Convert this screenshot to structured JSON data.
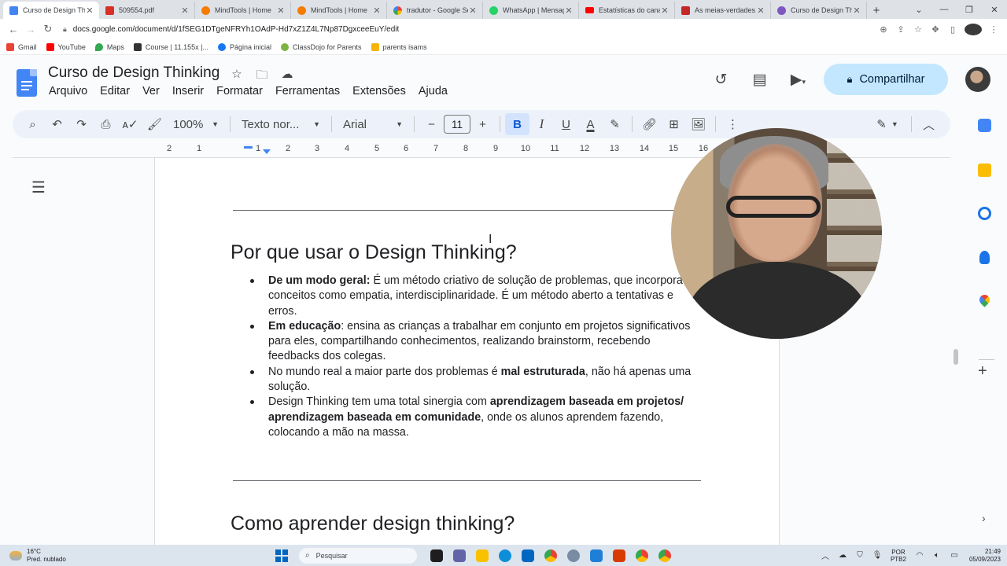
{
  "browser": {
    "tabs": [
      {
        "label": "Curso de Design Thinking",
        "color": "#4285f4",
        "active": true
      },
      {
        "label": "509554.pdf",
        "color": "#d93025"
      },
      {
        "label": "MindTools | Home",
        "color": "#f57c00"
      },
      {
        "label": "MindTools | Home",
        "color": "#f57c00"
      },
      {
        "label": "tradutor - Google Search",
        "color": "#4285f4"
      },
      {
        "label": "WhatsApp | Mensagens",
        "color": "#25d366"
      },
      {
        "label": "Estatísticas do canal",
        "color": "#ff0000"
      },
      {
        "label": "As meias-verdades, p",
        "color": "#c62828"
      },
      {
        "label": "Curso de Design Thinking",
        "color": "#7e57c2"
      }
    ],
    "new_tab": "+",
    "url": "docs.google.com/document/d/1fSEG1DTgeNFRYh1OAdP-Hd7xZ1Z4L7Np87DgxceeEuY/edit",
    "bookmarks": [
      {
        "label": "Gmail",
        "color": "#ea4335"
      },
      {
        "label": "YouTube",
        "color": "#ff0000"
      },
      {
        "label": "Maps",
        "color": "#34a853"
      },
      {
        "label": "Course | 11.155x |...",
        "color": "#333333"
      },
      {
        "label": "Página inicial",
        "color": "#1877f2"
      },
      {
        "label": "ClassDojo for Parents",
        "color": "#7cb342"
      },
      {
        "label": "parents isams",
        "color": "#f6b400"
      }
    ]
  },
  "docs": {
    "title": "Curso de Design Thinking",
    "menu": [
      "Arquivo",
      "Editar",
      "Ver",
      "Inserir",
      "Formatar",
      "Ferramentas",
      "Extensões",
      "Ajuda"
    ],
    "share_label": "Compartilhar",
    "toolbar": {
      "zoom": "100%",
      "style": "Texto nor...",
      "font": "Arial",
      "font_size": "11",
      "bold": "B",
      "italic": "I",
      "underline": "U",
      "text_color": "A"
    },
    "ruler": [
      "2",
      "1",
      "1",
      "2",
      "3",
      "4",
      "5",
      "6",
      "7",
      "8",
      "9",
      "10",
      "11",
      "12",
      "13",
      "14",
      "15",
      "16"
    ]
  },
  "content": {
    "heading1": "Por que usar o Design Thinking?",
    "bullets": [
      {
        "bold": "De um modo geral:",
        "text": " É um método criativo de solução de problemas, que incorpora conceitos como empatia, interdisciplinaridade. É um método aberto a tentativas e erros."
      },
      {
        "bold": "Em educação",
        "text": ": ensina as crianças a trabalhar em conjunto em projetos significativos para eles, compartilhando conhecimentos, realizando brainstorm, recebendo feedbacks dos colegas."
      },
      {
        "pre": "No mundo real a maior parte dos problemas é ",
        "bold": "mal estruturada",
        "text": ", não há apenas uma solução."
      },
      {
        "pre": "Design Thinking tem uma total sinergia com ",
        "bold": "aprendizagem baseada em projetos/ aprendizagem baseada em comunidade",
        "text": ", onde os alunos aprendem fazendo, colocando a mão na massa."
      }
    ],
    "heading2": "Como aprender design thinking?"
  },
  "taskbar": {
    "temperature": "16°C",
    "weather": "Pred. nublado",
    "search_placeholder": "Pesquisar",
    "lang_top": "POR",
    "lang_bottom": "PTB2",
    "time": "21:49",
    "date": "05/09/2023"
  }
}
